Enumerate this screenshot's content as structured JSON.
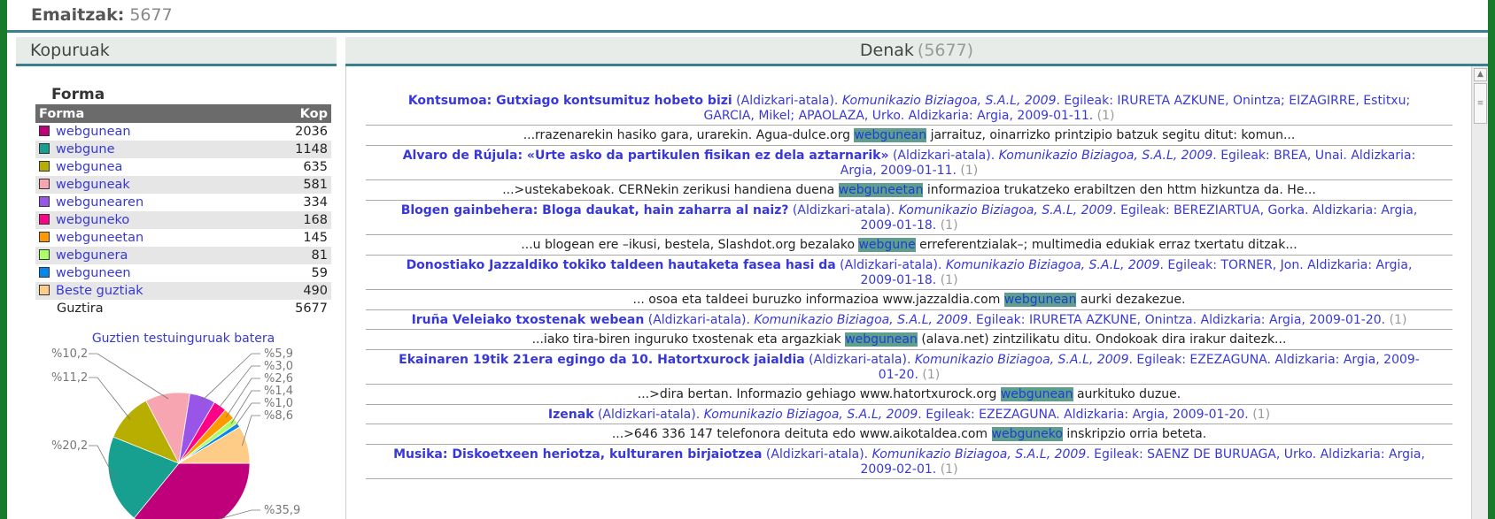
{
  "header": {
    "label": "Emaitzak:",
    "count": "5677"
  },
  "left_panel": {
    "title": "Kopuruak",
    "section_title": "Forma",
    "table": {
      "col_form": "Forma",
      "col_count": "Kop",
      "rows": [
        {
          "name": "webgunean",
          "count": "2036",
          "color": "#c0007a"
        },
        {
          "name": "webgune",
          "count": "1148",
          "color": "#17a08f"
        },
        {
          "name": "webgunea",
          "count": "635",
          "color": "#b8ae00"
        },
        {
          "name": "webguneak",
          "count": "581",
          "color": "#f7a5b0"
        },
        {
          "name": "webgunearen",
          "count": "334",
          "color": "#9955e8"
        },
        {
          "name": "webguneko",
          "count": "168",
          "color": "#ff0088"
        },
        {
          "name": "webguneetan",
          "count": "145",
          "color": "#ff9900"
        },
        {
          "name": "webgunera",
          "count": "81",
          "color": "#aaff66"
        },
        {
          "name": "webguneen",
          "count": "59",
          "color": "#0088ee"
        },
        {
          "name": "Beste guztiak",
          "count": "490",
          "color": "#ffcc88"
        }
      ],
      "total_label": "Guztira",
      "total_count": "5677"
    },
    "pie_title": "Guztien testuinguruak batera"
  },
  "chart_data": {
    "type": "pie",
    "title": "Guztien testuinguruak batera",
    "slices": [
      {
        "name": "webgunean",
        "value": 35.9,
        "label": "%35,9",
        "color": "#c0007a"
      },
      {
        "name": "webgune",
        "value": 20.2,
        "label": "%20,2",
        "color": "#17a08f"
      },
      {
        "name": "webgunea",
        "value": 11.2,
        "label": "%11,2",
        "color": "#b8ae00"
      },
      {
        "name": "webguneak",
        "value": 10.2,
        "label": "%10,2",
        "color": "#f7a5b0"
      },
      {
        "name": "webgunearen",
        "value": 5.9,
        "label": "%5,9",
        "color": "#9955e8"
      },
      {
        "name": "webguneko",
        "value": 3.0,
        "label": "%3,0",
        "color": "#ff0088"
      },
      {
        "name": "webguneetan",
        "value": 2.6,
        "label": "%2,6",
        "color": "#ff9900"
      },
      {
        "name": "webgunera",
        "value": 1.4,
        "label": "%1,4",
        "color": "#aaff66"
      },
      {
        "name": "webguneen",
        "value": 1.0,
        "label": "%1,0",
        "color": "#0088ee"
      },
      {
        "name": "Beste guztiak",
        "value": 8.6,
        "label": "%8,6",
        "color": "#ffcc88"
      }
    ]
  },
  "right_panel": {
    "title": "Denak",
    "count": "(5677)",
    "results": [
      {
        "title": "Kontsumoa: Gutxiago kontsumituz hobeto bizi",
        "kind": " (Aldizkari-atala). ",
        "publisher": "Komunikazio Biziagoa, S.A.L, 2009",
        "rest": ". Egileak: IRURETA AZKUNE, Onintza; EIZAGIRRE, Estitxu; GARCIA, Mikel; APAOLAZA, Urko. Aldizkaria: Argia, 2009-01-11. ",
        "n": "(1)",
        "ctx_pre": "...rrazenarekin hasiko gara, urarekin. Agua-dulce.org ",
        "ctx_hl": "webgunean",
        "ctx_post": " jarraituz, oinarrizko printzipio batzuk segitu ditut: komun..."
      },
      {
        "title": "Alvaro de Rújula: «Urte asko da partikulen fisikan ez dela aztarnarik»",
        "kind": " (Aldizkari-atala). ",
        "publisher": "Komunikazio Biziagoa, S.A.L, 2009",
        "rest": ". Egileak: BREA, Unai. Aldizkaria: Argia, 2009-01-11. ",
        "n": "(1)",
        "ctx_pre": "...>ustekabekoak. CERNekin zerikusi handiena duena ",
        "ctx_hl": "webguneetan",
        "ctx_post": " informazioa trukatzeko erabiltzen den httm hizkuntza da. He..."
      },
      {
        "title": "Blogen gainbehera: Bloga daukat, hain zaharra al naiz?",
        "kind": " (Aldizkari-atala). ",
        "publisher": "Komunikazio Biziagoa, S.A.L, 2009",
        "rest": ". Egileak: BEREZIARTUA, Gorka. Aldizkaria: Argia, 2009-01-18. ",
        "n": "(1)",
        "ctx_pre": "...u blogean ere –ikusi, bestela, Slashdot.org bezalako ",
        "ctx_hl": "webgune",
        "ctx_post": " erreferentzialak–; multimedia edukiak erraz txertatu ditzak..."
      },
      {
        "title": "Donostiako Jazzaldiko tokiko taldeen hautaketa fasea hasi da",
        "kind": " (Aldizkari-atala). ",
        "publisher": "Komunikazio Biziagoa, S.A.L, 2009",
        "rest": ". Egileak: TORNER, Jon. Aldizkaria: Argia, 2009-01-18. ",
        "n": "(1)",
        "ctx_pre": "... osoa eta taldeei buruzko informazioa www.jazzaldia.com ",
        "ctx_hl": "webgunean",
        "ctx_post": " aurki dezakezue."
      },
      {
        "title": "Iruña Veleiako txostenak webean",
        "kind": " (Aldizkari-atala). ",
        "publisher": "Komunikazio Biziagoa, S.A.L, 2009",
        "rest": ". Egileak: IRURETA AZKUNE, Onintza. Aldizkaria: Argia, 2009-01-20. ",
        "n": "(1)",
        "ctx_pre": "...iako tira-biren inguruko txostenak eta argazkiak ",
        "ctx_hl": "webgunean",
        "ctx_post": " (alava.net) zintzilikatu ditu. Ondokoak dira irakur daitezk..."
      },
      {
        "title": "Ekainaren 19tik 21era egingo da 10. Hatortxurock jaialdia",
        "kind": " (Aldizkari-atala). ",
        "publisher": "Komunikazio Biziagoa, S.A.L, 2009",
        "rest": ". Egileak: EZEZAGUNA. Aldizkaria: Argia, 2009-01-20. ",
        "n": "(1)",
        "ctx_pre": "...>dira bertan. Informazio gehiago www.hatortxurock.org ",
        "ctx_hl": "webgunean",
        "ctx_post": " aurkituko duzue."
      },
      {
        "title": "Izenak",
        "kind": " (Aldizkari-atala). ",
        "publisher": "Komunikazio Biziagoa, S.A.L, 2009",
        "rest": ". Egileak: EZEZAGUNA. Aldizkaria: Argia, 2009-01-20. ",
        "n": "(1)",
        "ctx_pre": "...>646 336 147 telefonora deituta edo www.aikotaldea.com ",
        "ctx_hl": "webguneko",
        "ctx_post": " inskripzio orria beteta."
      },
      {
        "title": "Musika: Diskoetxeen heriotza, kulturaren birjaiotzea",
        "kind": " (Aldizkari-atala). ",
        "publisher": "Komunikazio Biziagoa, S.A.L, 2009",
        "rest": ". Egileak: SAENZ DE BURUAGA, Urko. Aldizkaria: Argia, 2009-02-01. ",
        "n": "(1)",
        "ctx_pre": "",
        "ctx_hl": "",
        "ctx_post": ""
      }
    ]
  }
}
